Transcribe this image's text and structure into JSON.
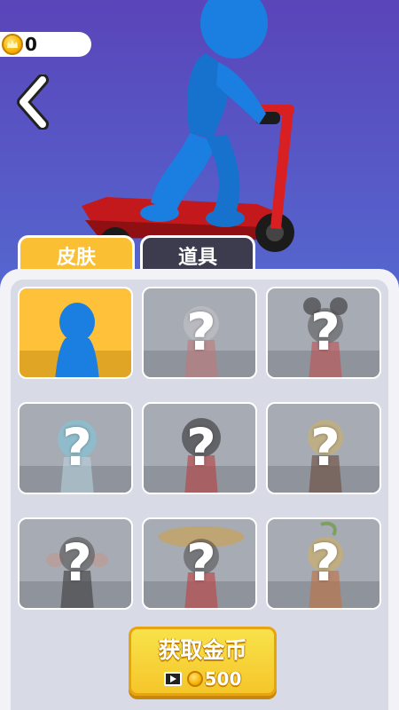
{
  "header": {
    "coins": "0"
  },
  "tabs": [
    {
      "label": "皮肤",
      "active": true
    },
    {
      "label": "道具",
      "active": false
    }
  ],
  "grid": {
    "items": [
      {
        "name": "blue-stickman",
        "locked": false,
        "selected": true
      },
      {
        "name": "locked-skin-2",
        "locked": true,
        "lock_symbol": "?"
      },
      {
        "name": "locked-skin-3",
        "locked": true,
        "lock_symbol": "?"
      },
      {
        "name": "locked-skin-4",
        "locked": true,
        "lock_symbol": "?"
      },
      {
        "name": "locked-skin-5",
        "locked": true,
        "lock_symbol": "?"
      },
      {
        "name": "locked-skin-6",
        "locked": true,
        "lock_symbol": "?"
      },
      {
        "name": "locked-skin-7",
        "locked": true,
        "lock_symbol": "?"
      },
      {
        "name": "locked-skin-8",
        "locked": true,
        "lock_symbol": "?"
      },
      {
        "name": "locked-skin-9",
        "locked": true,
        "lock_symbol": "?"
      }
    ]
  },
  "get_coins": {
    "title": "获取金币",
    "price": "500"
  },
  "colors": {
    "accent": "#fbbf34",
    "tab_inactive": "#3d3c4f",
    "player": "#1a7fe0",
    "scooter": "#d81f22"
  },
  "icons": {
    "back": "chevron-left-icon",
    "coin": "crown-coin-icon",
    "video": "video-ad-icon"
  }
}
